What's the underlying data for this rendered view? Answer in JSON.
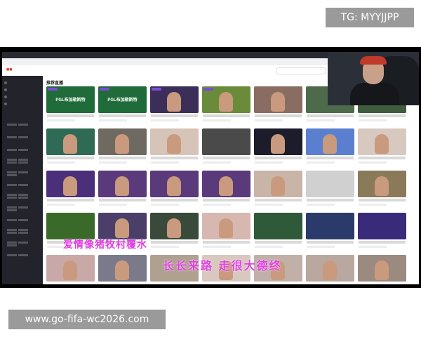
{
  "watermark_top": "TG: MYYJJPP",
  "watermark_bottom": "www.go-fifa-wc2026.com",
  "subtitle_line1": "爱情像猪牧村覆水",
  "subtitle_line2": "长长来路 走很大德终",
  "site": {
    "section_title": "推荐直播",
    "thumb_text": "PGL布加勒斯特"
  },
  "colors": {
    "accent": "#e0402e",
    "sidebar": "#23232c"
  }
}
